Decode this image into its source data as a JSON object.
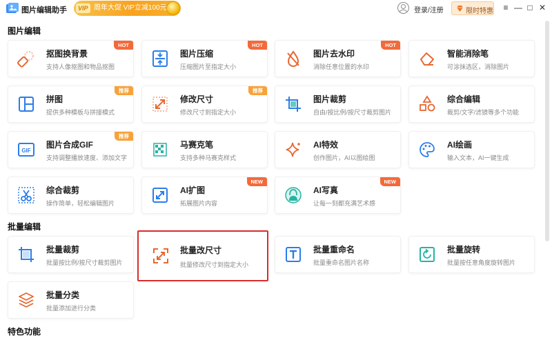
{
  "app": {
    "title": "图片编辑助手",
    "logo_icon": "image-app-logo-icon"
  },
  "promo": {
    "vip_tag": "VIP",
    "text": "周年大促 VIP立减100元",
    "coin_icon": "coin-icon"
  },
  "header": {
    "login_label": "登录/注册",
    "vip_button_label": "限时特惠",
    "user_icon": "user-icon",
    "diamond_icon": "diamond-icon"
  },
  "window_controls": {
    "menu": "≡",
    "minimize": "—",
    "maximize": "□",
    "close": "✕"
  },
  "sections": [
    {
      "title": "图片编辑",
      "cards": [
        {
          "title": "抠图换背景",
          "desc": "支持人像抠图和物品抠图",
          "badge": "HOT",
          "icon": "eraser-cutout-icon"
        },
        {
          "title": "图片压缩",
          "desc": "压缩图片至指定大小",
          "badge": "HOT",
          "icon": "compress-icon"
        },
        {
          "title": "图片去水印",
          "desc": "消除任意位置的水印",
          "badge": "HOT",
          "icon": "watermark-remove-icon"
        },
        {
          "title": "智能消除笔",
          "desc": "可涂抹选区，消除图片",
          "badge": "",
          "icon": "smart-eraser-icon"
        },
        {
          "title": "拼图",
          "desc": "提供多种模板与拼接模式",
          "badge": "推荐",
          "icon": "collage-icon"
        },
        {
          "title": "修改尺寸",
          "desc": "修改尺寸到指定大小",
          "badge": "推荐",
          "icon": "resize-icon"
        },
        {
          "title": "图片裁剪",
          "desc": "自由/按比例/按尺寸裁剪图片",
          "badge": "",
          "icon": "crop-icon"
        },
        {
          "title": "综合编辑",
          "desc": "裁剪/文字/滤镜等多个功能",
          "badge": "",
          "icon": "shapes-icon"
        },
        {
          "title": "图片合成GIF",
          "desc": "支持调整播放速度、添加文字",
          "badge": "推荐",
          "icon": "gif-icon"
        },
        {
          "title": "马赛克笔",
          "desc": "支持多种马赛克样式",
          "badge": "",
          "icon": "mosaic-icon"
        },
        {
          "title": "AI特效",
          "desc": "创作图片，AI以图绘图",
          "badge": "",
          "icon": "sparkle-icon"
        },
        {
          "title": "AI绘画",
          "desc": "输入文本，AI一键生成",
          "badge": "",
          "icon": "palette-icon"
        },
        {
          "title": "综合裁剪",
          "desc": "操作简单，轻松编辑图片",
          "badge": "",
          "icon": "scissors-icon"
        },
        {
          "title": "AI扩图",
          "desc": "拓展图片内容",
          "badge": "NEW",
          "icon": "expand-icon"
        },
        {
          "title": "AI写真",
          "desc": "让每一刻都充满艺术感",
          "badge": "NEW",
          "icon": "portrait-icon"
        }
      ]
    },
    {
      "title": "批量编辑",
      "cards": [
        {
          "title": "批量裁剪",
          "desc": "批量按比例/按尺寸裁剪图片",
          "badge": "",
          "icon": "batch-crop-icon"
        },
        {
          "title": "批量改尺寸",
          "desc": "批量修改尺寸到指定大小",
          "badge": "",
          "icon": "batch-resize-icon"
        },
        {
          "title": "批量重命名",
          "desc": "批量重命名图片名称",
          "badge": "",
          "icon": "rename-icon"
        },
        {
          "title": "批量旋转",
          "desc": "批量按任意角度旋转图片",
          "badge": "",
          "icon": "rotate-icon"
        },
        {
          "title": "批量分类",
          "desc": "批量添加进行分类",
          "badge": "",
          "icon": "layers-icon"
        }
      ]
    },
    {
      "title": "特色功能",
      "cards": []
    }
  ],
  "colors": {
    "accent_orange": "#f36a3a",
    "icon_blue": "#2b7de9",
    "icon_teal": "#26b3a3",
    "selected_border": "#d92b2b"
  }
}
